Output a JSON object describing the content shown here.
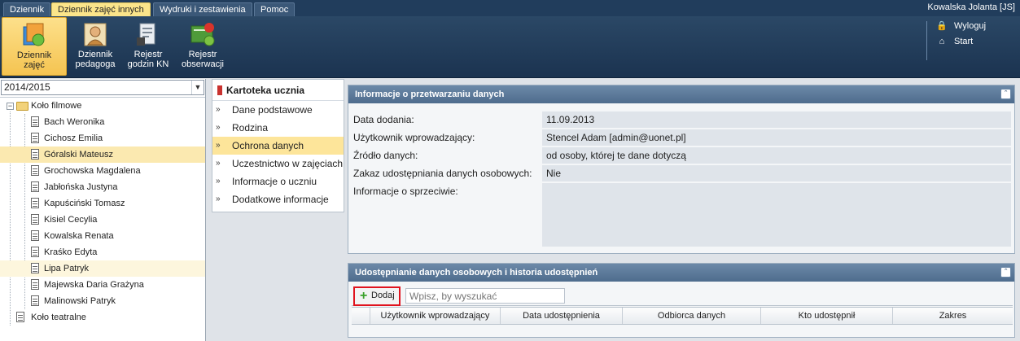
{
  "menu": {
    "tabs": [
      "Dziennik",
      "Dziennik zajęć innych",
      "Wydruki i zestawienia",
      "Pomoc"
    ],
    "active_tab": "Dziennik zajęć innych",
    "user": "Kowalska Jolanta [JS]"
  },
  "ribbon": {
    "buttons": [
      {
        "label": "Dziennik\nzajęć",
        "icon": "journal-icon"
      },
      {
        "label": "Dziennik\npedagoga",
        "icon": "pedagogue-icon"
      },
      {
        "label": "Rejestr\ngodzin KN",
        "icon": "hours-register-icon"
      },
      {
        "label": "Rejestr\nobserwacji",
        "icon": "observation-register-icon"
      }
    ],
    "logout": "Wyloguj",
    "start": "Start"
  },
  "left": {
    "year": "2014/2015",
    "groups": [
      {
        "name": "Koło filmowe",
        "students": [
          "Bach Weronika",
          "Cichosz Emilia",
          "Góralski Mateusz",
          "Grochowska Magdalena",
          "Jabłońska Justyna",
          "Kapuściński Tomasz",
          "Kisiel Cecylia",
          "Kowalska Renata",
          "Kraśko Edyta",
          "Lipa Patryk",
          "Majewska Daria Grażyna",
          "Malinowski Patryk"
        ]
      },
      {
        "name": "Koło teatralne",
        "students": []
      }
    ]
  },
  "nav": {
    "title": "Kartoteka ucznia",
    "items": [
      "Dane podstawowe",
      "Rodzina",
      "Ochrona danych",
      "Uczestnictwo w zajęciach",
      "Informacje o uczniu",
      "Dodatkowe informacje"
    ],
    "selected": "Ochrona danych"
  },
  "info_panel": {
    "title": "Informacje o przetwarzaniu danych",
    "fields": [
      {
        "label": "Data dodania:",
        "value": "11.09.2013"
      },
      {
        "label": "Użytkownik wprowadzający:",
        "value": "Stencel Adam [admin@uonet.pl]"
      },
      {
        "label": "Źródło danych:",
        "value": "od osoby, której te dane dotyczą"
      },
      {
        "label": "Zakaz udostępniania danych osobowych:",
        "value": "Nie"
      },
      {
        "label": "Informacje o sprzeciwie:",
        "value": ""
      }
    ]
  },
  "share_panel": {
    "title": "Udostępnianie danych osobowych i historia udostępnień",
    "add_label": "Dodaj",
    "search_placeholder": "Wpisz, by wyszukać",
    "columns": [
      "Użytkownik wprowadzający",
      "Data udostępnienia",
      "Odbiorca danych",
      "Kto udostępnił",
      "Zakres"
    ]
  },
  "colors": {
    "menubar": "#213d5c",
    "active": "#fde59a",
    "panel_header": "#5b7a9b",
    "highlight_border": "#e0131e"
  }
}
